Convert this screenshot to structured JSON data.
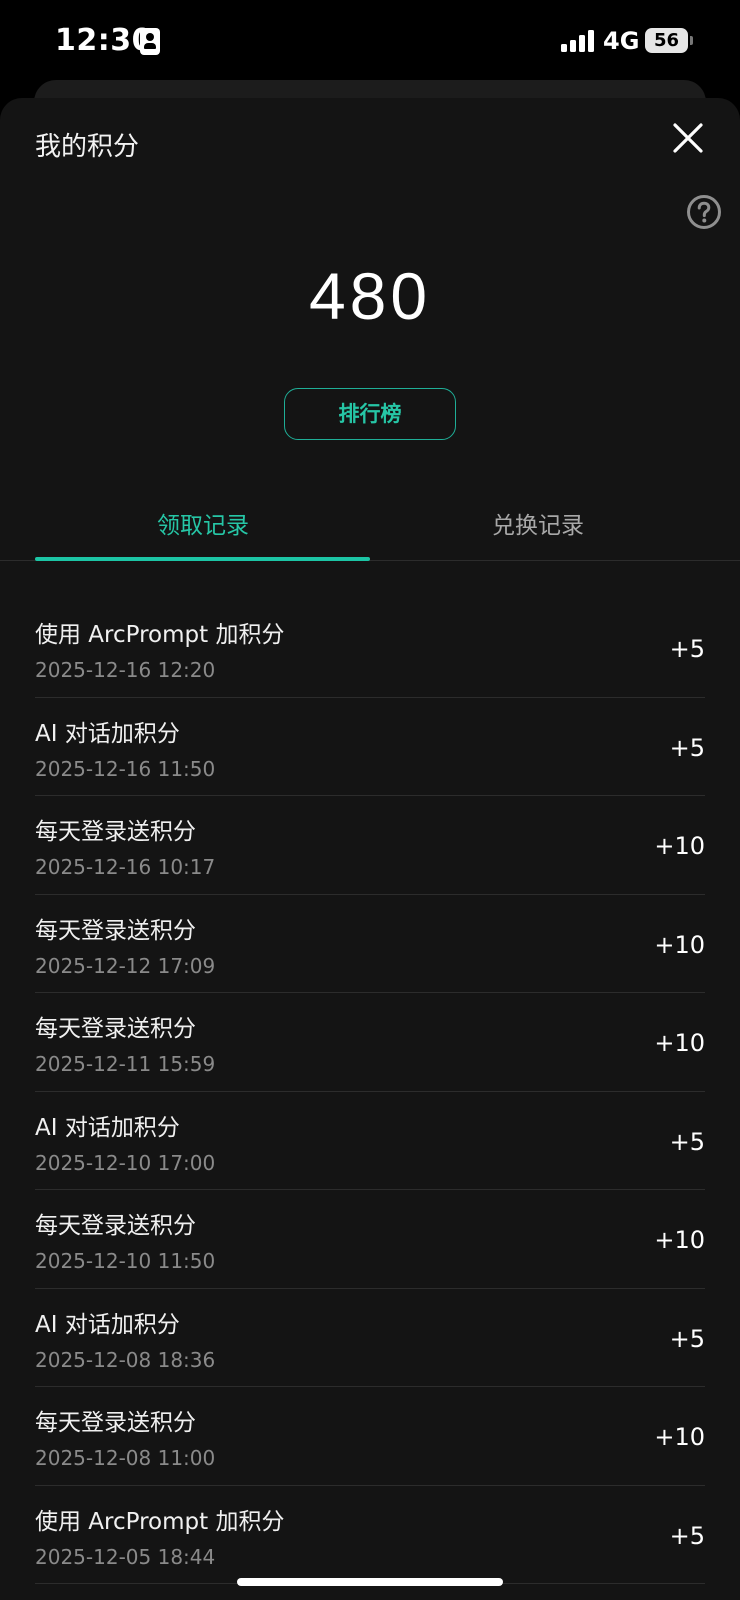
{
  "status_bar": {
    "time": "12:30",
    "network": "4G",
    "battery": "56",
    "icons": [
      "contact-card-icon",
      "signal-icon",
      "battery-icon"
    ]
  },
  "header": {
    "title": "我的积分",
    "close_icon": "close-icon",
    "help_icon": "help-icon"
  },
  "points": {
    "value": "480"
  },
  "leaderboard_button": {
    "label": "排行榜"
  },
  "tabs": [
    {
      "label": "领取记录",
      "active": true
    },
    {
      "label": "兑换记录",
      "active": false
    }
  ],
  "records": [
    {
      "title": "使用 ArcPrompt 加积分",
      "time": "2025-12-16 12:20",
      "amount": "+5"
    },
    {
      "title": "AI 对话加积分",
      "time": "2025-12-16 11:50",
      "amount": "+5"
    },
    {
      "title": "每天登录送积分",
      "time": "2025-12-16 10:17",
      "amount": "+10"
    },
    {
      "title": "每天登录送积分",
      "time": "2025-12-12 17:09",
      "amount": "+10"
    },
    {
      "title": "每天登录送积分",
      "time": "2025-12-11 15:59",
      "amount": "+10"
    },
    {
      "title": "AI 对话加积分",
      "time": "2025-12-10 17:00",
      "amount": "+5"
    },
    {
      "title": "每天登录送积分",
      "time": "2025-12-10 11:50",
      "amount": "+10"
    },
    {
      "title": "AI 对话加积分",
      "time": "2025-12-08 18:36",
      "amount": "+5"
    },
    {
      "title": "每天登录送积分",
      "time": "2025-12-08 11:00",
      "amount": "+10"
    },
    {
      "title": "使用 ArcPrompt 加积分",
      "time": "2025-12-05 18:44",
      "amount": "+5"
    }
  ],
  "colors": {
    "accent": "#26c6a6",
    "background": "#141414",
    "divider": "#2c2c2c",
    "secondary_text": "#8a8a8a"
  }
}
